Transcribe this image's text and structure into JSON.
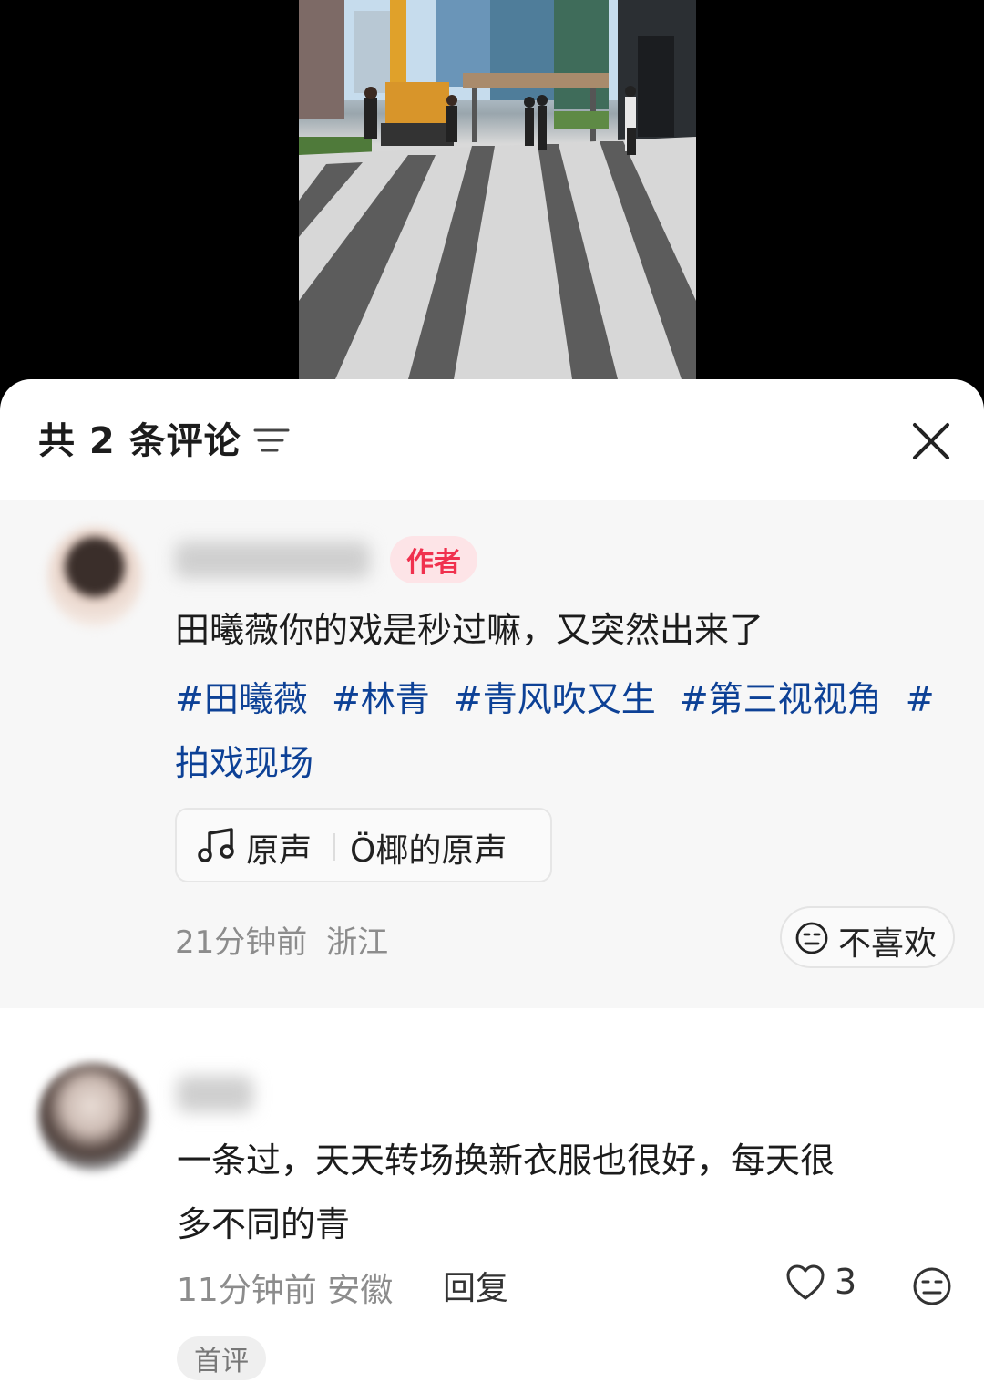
{
  "header": {
    "comment_count_label": "共 2 条评论",
    "sort_icon": "sort-filter-icon",
    "close_icon": "close-icon"
  },
  "comments": [
    {
      "is_author": true,
      "author_badge": "作者",
      "text": "田曦薇你的戏是秒过嘛，又突然出来了",
      "hashtags": [
        "#田曦薇",
        "#林青",
        "#青风吹又生",
        "#第三视视角",
        "#拍戏现场"
      ],
      "audio": {
        "icon": "music-note-icon",
        "label": "原声",
        "title": "Ö椰的原声"
      },
      "time": "21分钟前",
      "location": "浙江",
      "dislike_label": "不喜欢"
    },
    {
      "is_author": false,
      "text_line1": "一条过，天天转场换新衣服也很好，每天很",
      "text_line2": "多不同的青",
      "time_location": "11分钟前 安徽",
      "reply_label": "回复",
      "likes": "3",
      "first_badge": "首评"
    }
  ],
  "colors": {
    "hashtag": "#0d4196",
    "author_badge_text": "#f0314e",
    "author_badge_bg": "#fde4e7",
    "pinned_bg": "#f7f7f7"
  }
}
